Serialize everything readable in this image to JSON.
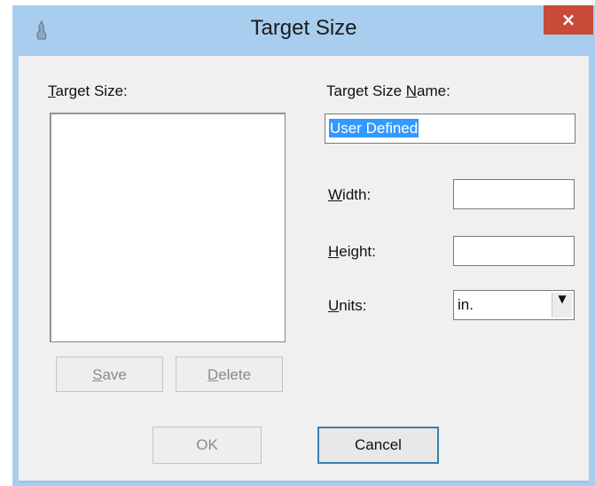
{
  "window": {
    "title": "Target Size",
    "close_glyph": "×"
  },
  "left": {
    "target_size_label_hotkey": "T",
    "target_size_label_rest": "arget Size:",
    "save_hotkey": "S",
    "save_rest": "ave",
    "delete_hotkey": "D",
    "delete_rest": "elete"
  },
  "right": {
    "name_label_pre": "Target Size ",
    "name_label_hotkey": "N",
    "name_label_rest": "ame:",
    "name_value": "User Defined",
    "width_hotkey": "W",
    "width_rest": "idth:",
    "width_value": "",
    "height_hotkey": "H",
    "height_rest": "eight:",
    "height_value": "",
    "units_hotkey": "U",
    "units_rest": "nits:",
    "units_value": "in."
  },
  "footer": {
    "ok_label": "OK",
    "cancel_label": "Cancel"
  },
  "icons": {
    "app": "scanner-app-icon",
    "close": "close-icon",
    "dropdown": "chevron-down-icon"
  },
  "colors": {
    "titlebar": "#a9cdee",
    "close": "#c84b3a",
    "selection": "#3399ff"
  }
}
